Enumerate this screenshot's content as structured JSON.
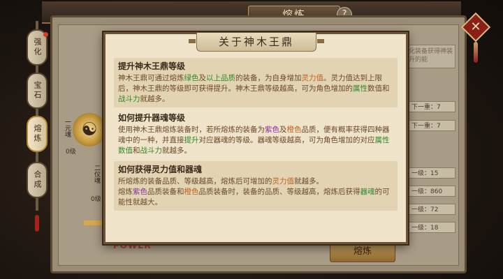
{
  "window": {
    "title": "熔炼",
    "help_label": "?",
    "close_label": "✕"
  },
  "side_tabs": [
    {
      "label": "强化",
      "active": false
    },
    {
      "label": "宝石",
      "active": false
    },
    {
      "label": "熔炼",
      "active": true
    },
    {
      "label": "合成",
      "active": false
    }
  ],
  "background": {
    "top_right_note": "熔化装备获得神装提升的能",
    "next_level_1": "下一重：7",
    "next_level_2": "下一重：7",
    "level_rows": [
      "一级：15",
      "一级：860",
      "一级：72",
      "一级：18"
    ],
    "left_label_1": "一元魂",
    "left_label_2": "二仪魂",
    "left_value_1": "0级",
    "left_value_2": "0级",
    "red_text": "POWER",
    "forge_button": "熔炼"
  },
  "popup": {
    "title": "关于神木王鼎",
    "sections": [
      {
        "heading": "提升神木王鼎等级",
        "segments": [
          {
            "t": "神木王鼎可通过熔炼",
            "c": ""
          },
          {
            "t": "绿色",
            "c": "green"
          },
          {
            "t": "及",
            "c": ""
          },
          {
            "t": "以上品质",
            "c": "green"
          },
          {
            "t": "的装备，为自身增加",
            "c": ""
          },
          {
            "t": "灵力值",
            "c": "orange"
          },
          {
            "t": "。灵力值达到上限后，神木王鼎的等级即可获得提升。神木王鼎等级越高，可为角色增加的",
            "c": ""
          },
          {
            "t": "属性",
            "c": "green"
          },
          {
            "t": "数值和",
            "c": ""
          },
          {
            "t": "战斗力",
            "c": "green"
          },
          {
            "t": "就越多。",
            "c": ""
          }
        ]
      },
      {
        "heading": "如何提升器魂等级",
        "segments": [
          {
            "t": "使用神木王鼎熔炼装备时，若所熔炼的装备为",
            "c": ""
          },
          {
            "t": "紫色",
            "c": "purple"
          },
          {
            "t": "及",
            "c": ""
          },
          {
            "t": "橙色",
            "c": "orange"
          },
          {
            "t": "品质，便有概率获得四种器魂中的一种，并直接",
            "c": ""
          },
          {
            "t": "提升",
            "c": "green"
          },
          {
            "t": "对应器魂的等级。器魂等级越高，可为角色增加的对应",
            "c": ""
          },
          {
            "t": "属性数值",
            "c": "green"
          },
          {
            "t": "和",
            "c": ""
          },
          {
            "t": "战斗力",
            "c": "green"
          },
          {
            "t": "就越多。",
            "c": ""
          }
        ]
      },
      {
        "heading": "如何获得灵力值和器魂",
        "segments": [
          {
            "t": "所熔炼的装备品质、等级越高，熔炼后可增加的",
            "c": ""
          },
          {
            "t": "灵力值",
            "c": "orange"
          },
          {
            "t": "就越多。\n熔炼",
            "c": ""
          },
          {
            "t": "紫色",
            "c": "purple"
          },
          {
            "t": "品质装备和",
            "c": ""
          },
          {
            "t": "橙色",
            "c": "orange"
          },
          {
            "t": "品质装备时，装备的品质、等级越高，熔炼后获得",
            "c": ""
          },
          {
            "t": "器魂",
            "c": "green"
          },
          {
            "t": "的可能性就越大。",
            "c": ""
          }
        ]
      }
    ]
  }
}
